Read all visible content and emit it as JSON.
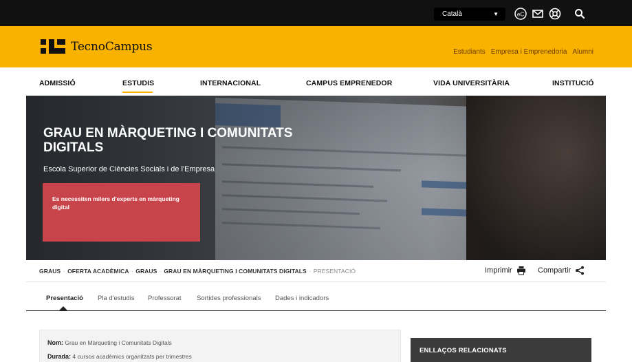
{
  "topbar": {
    "language": "Català",
    "icons": [
      "ec-icon",
      "mail-icon",
      "accessibility-icon",
      "search-icon"
    ]
  },
  "brand": {
    "name": "TecnoCampus",
    "links": [
      "Estudiants",
      "Empresa i Emprenedoria",
      "Alumni"
    ]
  },
  "nav": {
    "items": [
      "ADMISSIÓ",
      "ESTUDIS",
      "INTERNACIONAL",
      "CAMPUS EMPRENEDOR",
      "VIDA UNIVERSITÀRIA",
      "INSTITUCIÓ"
    ],
    "active": "ESTUDIS",
    "accent": "#f9b200"
  },
  "hero": {
    "title": "GRAU EN MÀRQUETING I COMUNITATS DIGITALS",
    "subtitle": "Escola Superior de Ciències Socials i de l'Empresa",
    "callout": "Es necessiten milers d'experts en màrqueting digital",
    "callout_color": "#c8444b"
  },
  "breadcrumb": {
    "items": [
      "GRAUS",
      "OFERTA ACADÈMICA",
      "GRAUS",
      "GRAU EN MÀRQUETING I COMUNITATS DIGITALS"
    ],
    "current": "PRESENTACIÓ",
    "separator": "·"
  },
  "actions": {
    "print": "Imprimir",
    "share": "Compartir"
  },
  "tabs": {
    "items": [
      "Presentació",
      "Pla d'estudis",
      "Professorat",
      "Sortides professionals",
      "Dades i indicadors"
    ],
    "active": "Presentació"
  },
  "info": {
    "name_label": "Nom:",
    "name_value": "Grau en Màrqueting i Comunitats Digitals",
    "duration_label": "Durada:",
    "duration_value": "4 cursos acadèmics organitzats per trimestres"
  },
  "related": {
    "title": "ENLLAÇOS RELACIONATS"
  }
}
